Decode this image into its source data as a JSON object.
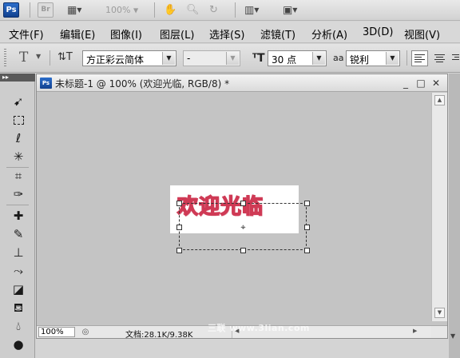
{
  "appbar": {
    "ps_logo": "Ps",
    "br_logo": "Br",
    "zoom_value": "100%"
  },
  "menu": [
    "文件(F)",
    "编辑(E)",
    "图像(I)",
    "图层(L)",
    "选择(S)",
    "滤镜(T)",
    "分析(A)",
    "3D(D)",
    "视图(V)"
  ],
  "options": {
    "tool_symbol": "T",
    "font_family": "方正彩云简体",
    "font_style": "-",
    "font_size": "30 点",
    "antialias_label": "aa",
    "antialias": "锐利"
  },
  "toolbox": {
    "header": "▸▸"
  },
  "document": {
    "ps_badge": "Ps",
    "title": "未标题-1 @ 100% (欢迎光临, RGB/8) *",
    "text_layer": "欢迎光临",
    "zoom": "100%",
    "doc_info": "文档:28.1K/9.38K"
  },
  "watermark": "三联 www.3lian.com",
  "colors": {
    "text_outline": "#cf3a55",
    "ps_blue": "#1f5fb8",
    "canvas_bg": "#c4c4c4"
  }
}
